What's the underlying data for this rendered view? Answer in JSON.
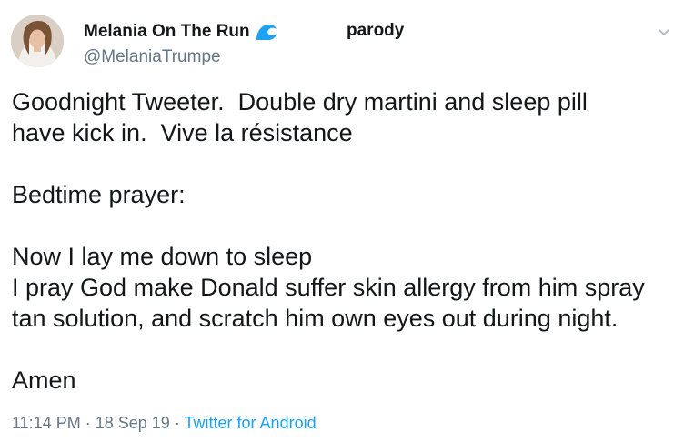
{
  "author": {
    "display_name": "Melania On The Run",
    "handle": "@MelaniaTrumpe",
    "label": "parody",
    "avatar_icon": "profile-photo",
    "name_emoji_icon": "water-wave-icon"
  },
  "menu": {
    "icon": "chevron-down-icon"
  },
  "tweet": {
    "lines": [
      "Goodnight Tweeter.  Double dry martini and sleep pill",
      "have kick in.  Vive la résistance",
      "",
      "Bedtime prayer:",
      "",
      "Now I lay me down to sleep",
      "I pray God make Donald suffer skin allergy from him spray",
      "tan solution, and scratch him own eyes out during night.",
      "",
      "Amen"
    ]
  },
  "meta": {
    "time": "11:14 PM",
    "separator": "·",
    "date": "18 Sep 19",
    "source": "Twitter for Android"
  },
  "colors": {
    "text": "#14171a",
    "secondary": "#657786",
    "link": "#1da1f2",
    "wave": "#1da1f2"
  }
}
